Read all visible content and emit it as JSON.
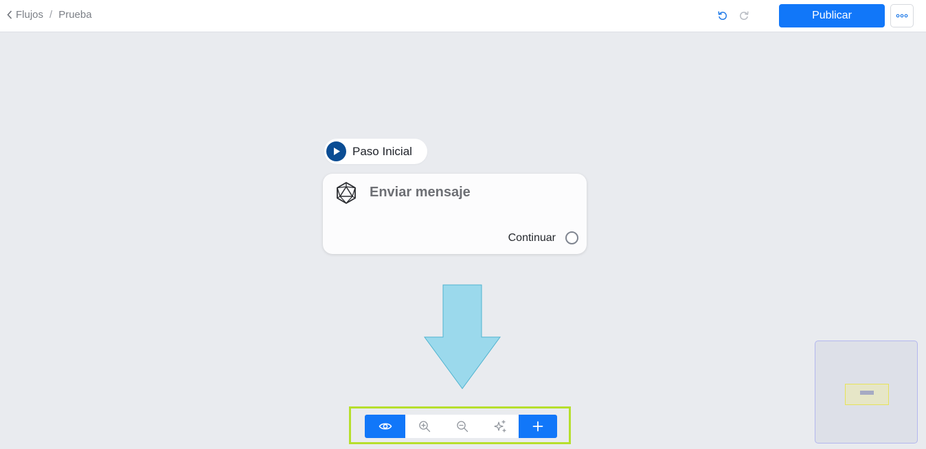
{
  "breadcrumb": {
    "parent": "Flujos",
    "separator": "/",
    "current": "Prueba"
  },
  "toolbar_top": {
    "publish_label": "Publicar"
  },
  "canvas": {
    "start_label": "Paso Inicial",
    "node": {
      "title": "Enviar mensaje",
      "output_label": "Continuar"
    }
  },
  "colors": {
    "primary": "#1177f9",
    "start_icon": "#0b4d94",
    "annotation_arrow": "#9bd9ec",
    "toolbar_highlight": "#b6df2c",
    "canvas_bg": "#e9ebef"
  },
  "icons": {
    "back": "chevron-left-icon",
    "undo": "undo-icon",
    "redo": "redo-icon",
    "more": "more-horizontal-icon",
    "start": "play-icon",
    "node": "polyhedron-icon",
    "preview": "eye-icon",
    "zoom_in": "zoom-in-icon",
    "zoom_out": "zoom-out-icon",
    "auto_layout": "sparkles-icon",
    "add": "plus-icon"
  }
}
